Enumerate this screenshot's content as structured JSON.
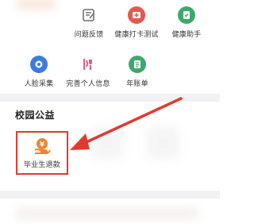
{
  "grid_row1": [
    {
      "label": "问题反馈",
      "icon": "feedback-icon",
      "color": "#6f6f6f"
    },
    {
      "label": "健康打卡测试",
      "icon": "health-checkin-icon",
      "color": "#e8564d"
    },
    {
      "label": "健康助手",
      "icon": "health-assistant-icon",
      "color": "#3fa86b"
    }
  ],
  "grid_row2": [
    {
      "label": "人脸采集",
      "icon": "face-capture-icon",
      "color": "#3d7be0"
    },
    {
      "label": "完善个人信息",
      "icon": "personal-info-icon",
      "color": "#e0607d"
    },
    {
      "label": "年账单",
      "icon": "annual-bill-icon",
      "color": "#3fa86b"
    }
  ],
  "campus_section": {
    "title": "校园公益",
    "items": [
      {
        "label": "毕业生退款",
        "icon": "graduate-refund-icon",
        "color": "#f0842b"
      }
    ]
  },
  "annotation": {
    "highlight_color": "#e33a2f"
  }
}
